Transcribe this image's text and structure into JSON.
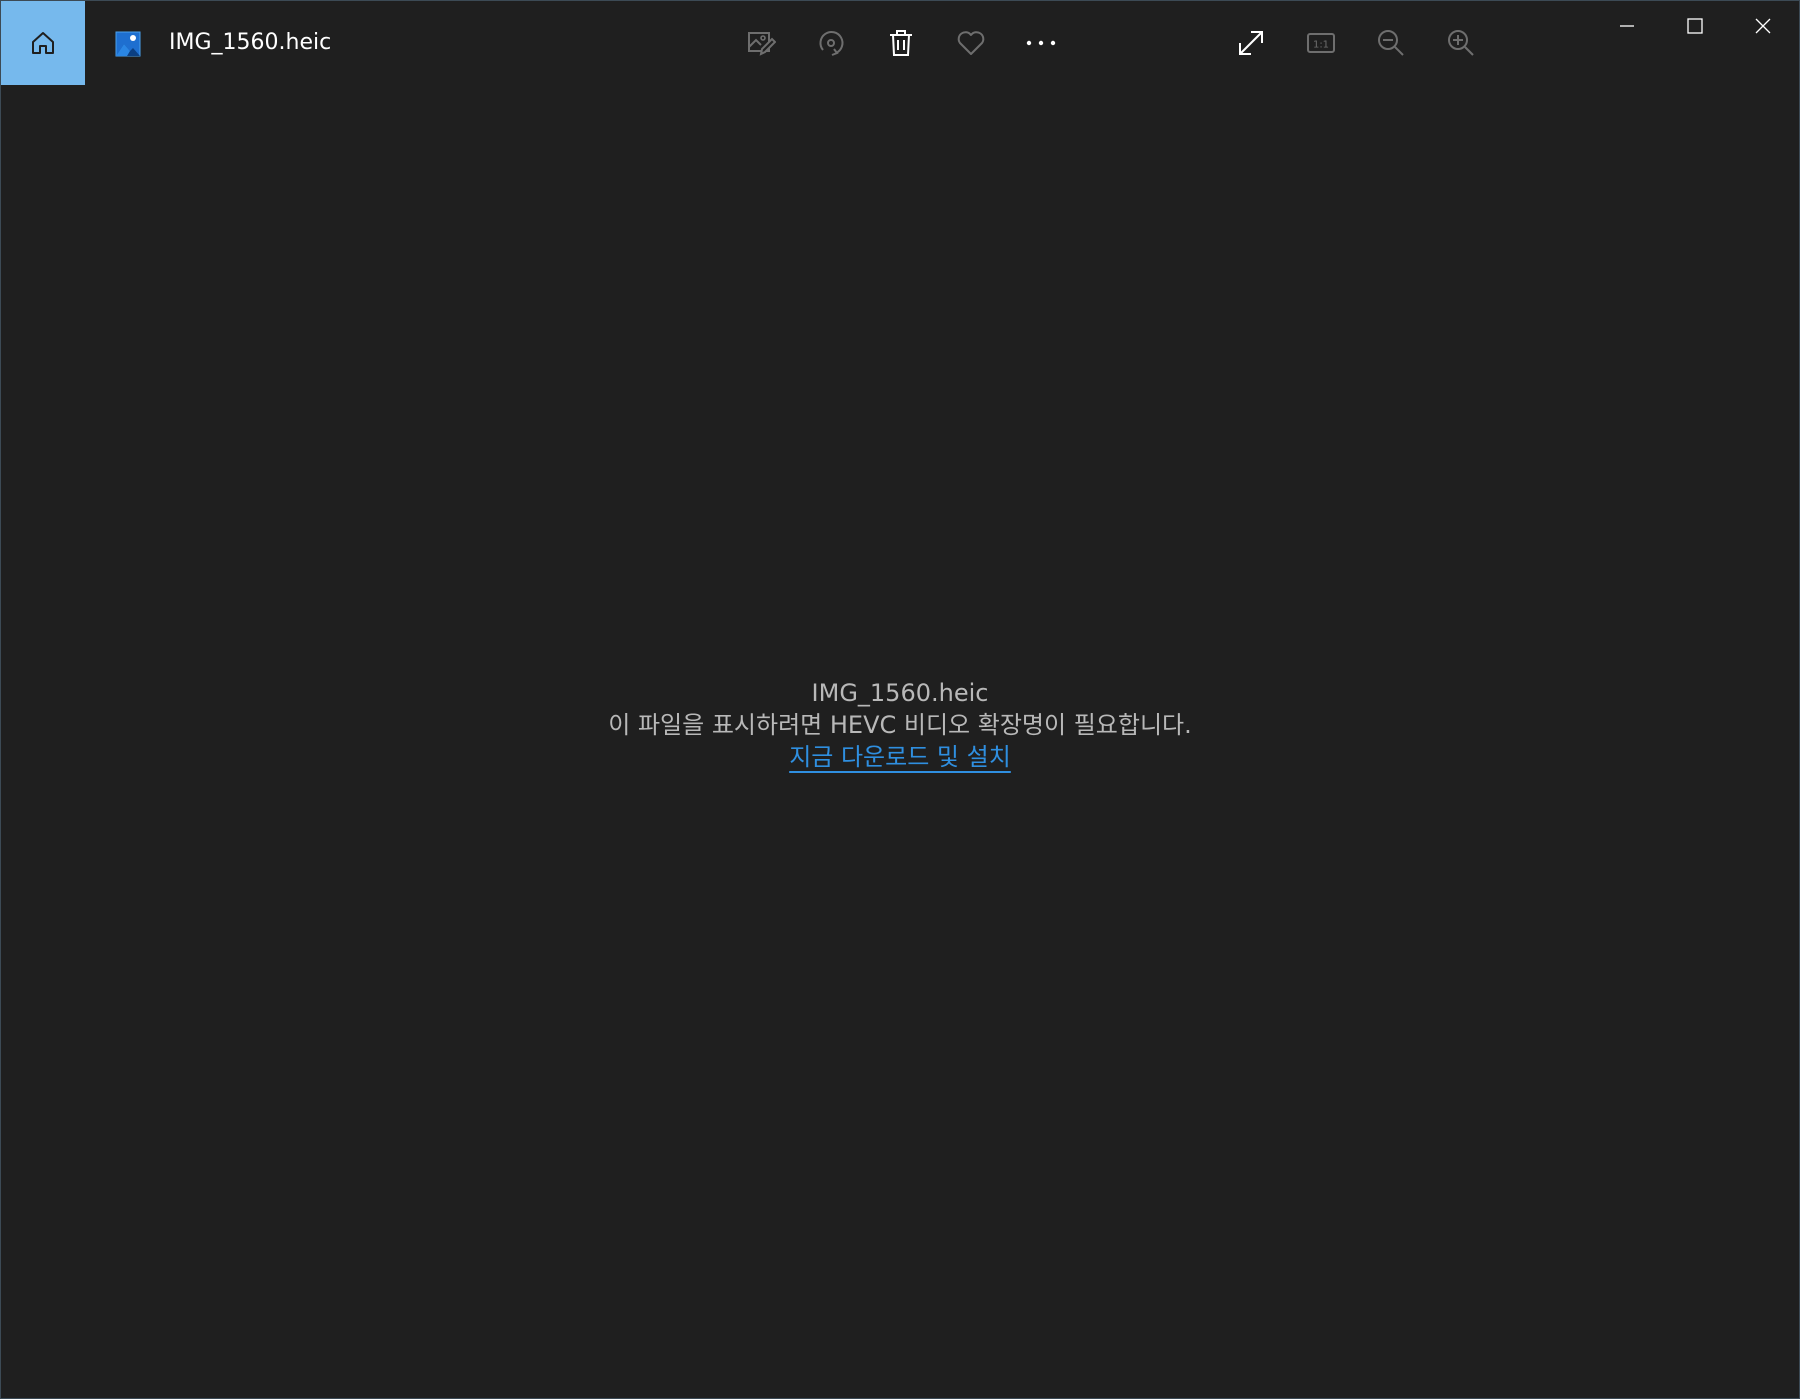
{
  "window": {
    "title": "IMG_1560.heic"
  },
  "toolbar": {
    "items": [
      {
        "name": "edit-image-button",
        "icon": "edit-image-icon",
        "enabled": false
      },
      {
        "name": "rotate-button",
        "icon": "rotate-icon",
        "enabled": false
      },
      {
        "name": "delete-button",
        "icon": "trash-icon",
        "enabled": true
      },
      {
        "name": "favorite-button",
        "icon": "heart-icon",
        "enabled": false
      },
      {
        "name": "more-button",
        "icon": "more-dots-icon",
        "enabled": true
      }
    ],
    "view_items": [
      {
        "name": "fullscreen-button",
        "icon": "expand-icon",
        "enabled": true
      },
      {
        "name": "actual-size-button",
        "icon": "actual-size-icon",
        "label": "1:1",
        "enabled": false
      },
      {
        "name": "zoom-out-button",
        "icon": "zoom-out-icon",
        "enabled": false
      },
      {
        "name": "zoom-in-button",
        "icon": "zoom-in-icon",
        "enabled": false
      }
    ]
  },
  "colors": {
    "background": "#1f1f1f",
    "home_accent": "#76b9ed",
    "link": "#2f8fe0",
    "text_muted": "#b8b8b8",
    "icon_enabled": "#ffffff",
    "icon_disabled": "#6e6e6e"
  },
  "message": {
    "filename": "IMG_1560.heic",
    "text": "이 파일을 표시하려면 HEVC 비디오 확장명이 필요합니다.",
    "link": "지금 다운로드 및 설치"
  }
}
